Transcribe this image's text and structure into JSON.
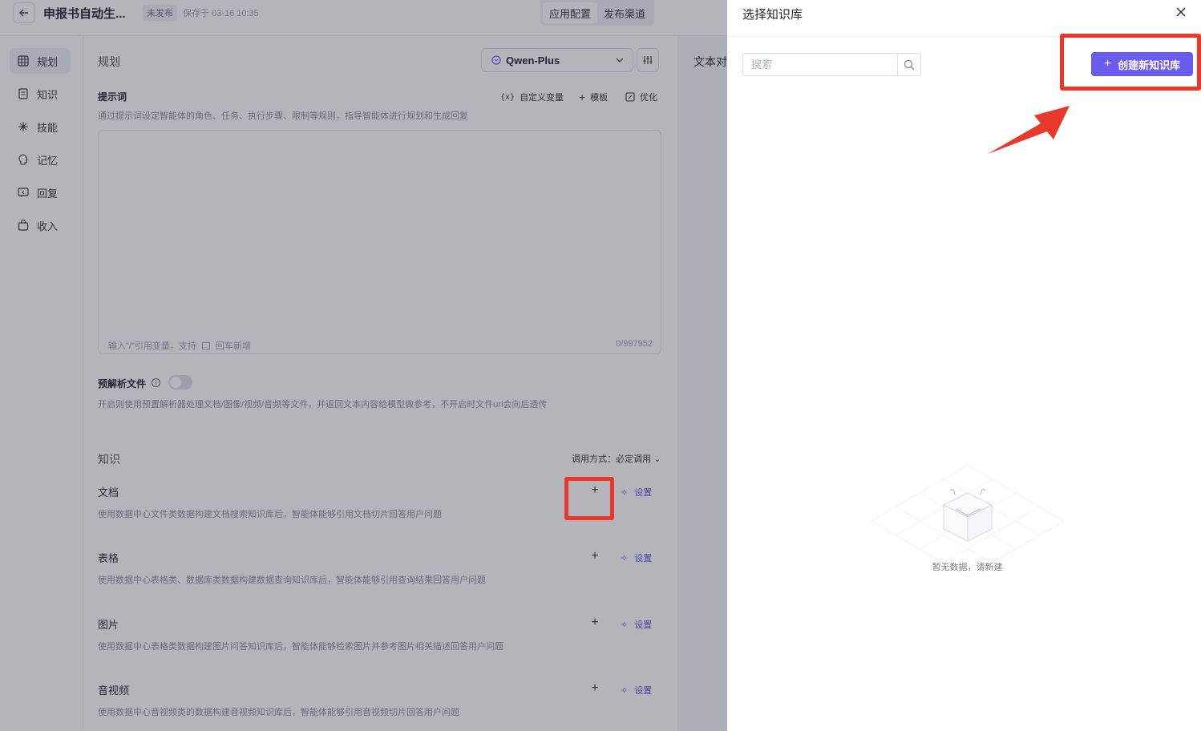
{
  "header": {
    "title": "申报书自动生...",
    "publish_status": "未发布",
    "saved_text": "保存于 03-16 10:35",
    "tabs": [
      "应用配置",
      "发布渠道"
    ]
  },
  "sidebar": {
    "items": [
      {
        "label": "规划",
        "icon": "grid-icon"
      },
      {
        "label": "知识",
        "icon": "document-icon"
      },
      {
        "label": "技能",
        "icon": "sparkle-icon"
      },
      {
        "label": "记忆",
        "icon": "brain-icon"
      },
      {
        "label": "回复",
        "icon": "reply-icon"
      },
      {
        "label": "收入",
        "icon": "bag-icon"
      }
    ]
  },
  "planning": {
    "title": "规划",
    "model": "Qwen-Plus",
    "prompt_label": "提示词",
    "prompt_desc": "通过提示词设定智能体的角色、任务、执行步骤、限制等规则，指导智能体进行规划和生成回复",
    "tools": [
      "自定义变量",
      "模板",
      "优化"
    ],
    "tool_icon_var": "{x}",
    "prompt_placeholder": "输入\"/\"引用变量，支持",
    "prompt_placeholder_tail": "回车新增",
    "prompt_count": "0/997952",
    "preparse_label": "预解析文件",
    "preparse_desc": "开启则使用预置解析器处理文档/图像/视频/音频等文件，并返回文本内容给模型做参考，不开启时文件url会向后透传"
  },
  "knowledge": {
    "title": "知识",
    "call_mode": "调用方式：必定调用",
    "settings_label": "设置",
    "rows": [
      {
        "name": "文档",
        "desc": "使用数据中心文件类数据构建文档搜索知识库后，智能体能够引用文档切片回答用户问题"
      },
      {
        "name": "表格",
        "desc": "使用数据中心表格类、数据库类数据构建数据查询知识库后，智能体能够引用查询结果回答用户问题"
      },
      {
        "name": "图片",
        "desc": "使用数据中心表格类数据构建图片问答知识库后，智能体能够检索图片并参考图片相关描述回答用户问题"
      },
      {
        "name": "音视频",
        "desc": "使用数据中心音视频类的数据构建音视频知识库后，智能体能够引用音视频切片回答用户问题"
      }
    ]
  },
  "right_panel": {
    "title": "文本对"
  },
  "drawer": {
    "title": "选择知识库",
    "search_placeholder": "搜索",
    "create_label": "创建新知识库",
    "empty_text": "暂无数据，请新建"
  },
  "colors": {
    "accent": "#6a5cf0",
    "highlight": "#e8382b"
  }
}
